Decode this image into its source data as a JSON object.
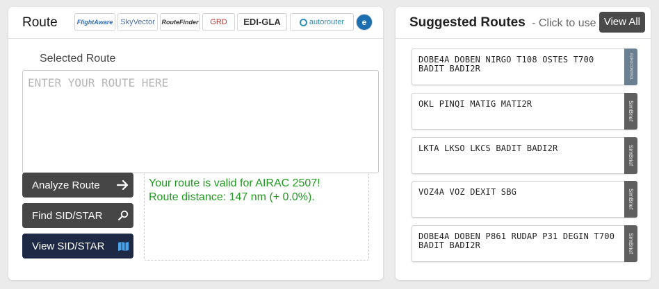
{
  "route_panel": {
    "title": "Route",
    "providers": [
      {
        "name": "FlightAware",
        "color": "#2f6db5"
      },
      {
        "name": "SkyVector",
        "color": "#4a6fa5"
      },
      {
        "name": "RouteFinder",
        "color": "#333"
      },
      {
        "name": "GRD",
        "color": "#c23030"
      },
      {
        "name": "EDI-GLA",
        "color": "#333"
      },
      {
        "name": "autorouter",
        "color": "#2f8fb5"
      },
      {
        "name": "e",
        "color": "#1b6fb0"
      }
    ],
    "selected_label": "Selected Route",
    "route_placeholder": "ENTER YOUR ROUTE HERE",
    "route_value": "",
    "buttons": {
      "analyze": "Analyze Route",
      "find": "Find SID/STAR",
      "view": "View SID/STAR"
    },
    "result": {
      "line1": "Your route is valid for AIRAC 2507!",
      "line2": "Route distance: 147 nm (+ 0.0%).",
      "color": "#1f9a1f"
    }
  },
  "suggest_panel": {
    "title": "Suggested Routes",
    "subtitle": "- Click to use",
    "view_all": "View All",
    "items": [
      {
        "route": "DOBE4A DOBEN NIRGO T108 OSTES T700 BADIT BADI2R",
        "source": "EUROCONTROL"
      },
      {
        "route": "OKL PINQI MATIG MATI2R",
        "source": "SimBrief"
      },
      {
        "route": "LKTA LKSO LKCS BADIT BADI2R",
        "source": "SimBrief"
      },
      {
        "route": "VOZ4A VOZ DEXIT SBG",
        "source": "SimBrief"
      },
      {
        "route": "DOBE4A DOBEN P861 RUDAP P31 DEGIN T700 BADIT BADI2R",
        "source": "SimBrief"
      }
    ]
  }
}
